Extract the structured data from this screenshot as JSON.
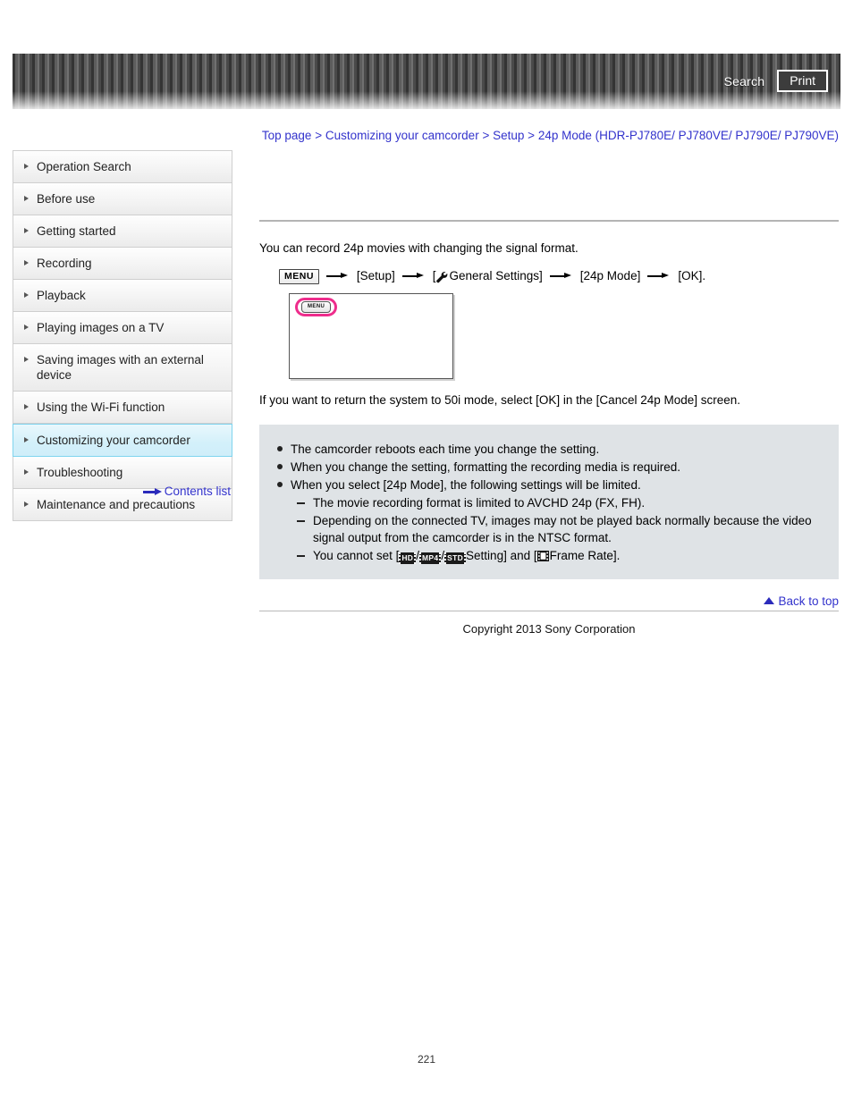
{
  "header": {
    "search_label": "Search",
    "print_label": "Print"
  },
  "breadcrumb": {
    "items": [
      {
        "label": "Top page"
      },
      {
        "label": "Customizing your camcorder"
      },
      {
        "label": "Setup"
      },
      {
        "label": "24p Mode (HDR-PJ780E/ PJ780VE/ PJ790E/ PJ790VE)"
      }
    ],
    "separator": ">"
  },
  "sidebar": {
    "items": [
      {
        "label": "Operation Search",
        "selected": false
      },
      {
        "label": "Before use",
        "selected": false
      },
      {
        "label": "Getting started",
        "selected": false
      },
      {
        "label": "Recording",
        "selected": false
      },
      {
        "label": "Playback",
        "selected": false
      },
      {
        "label": "Playing images on a TV",
        "selected": false
      },
      {
        "label": "Saving images with an external device",
        "selected": false
      },
      {
        "label": "Using the Wi-Fi function",
        "selected": false
      },
      {
        "label": "Customizing your camcorder",
        "selected": true
      },
      {
        "label": "Troubleshooting",
        "selected": false
      },
      {
        "label": "Maintenance and precautions",
        "selected": false
      }
    ],
    "contents_list_label": "Contents list",
    "contents_list_icon": "arrow-right-icon",
    "selected_bg_color": "#d3f0fa",
    "selected_border_color": "#7fd4ee"
  },
  "main": {
    "intro": "You can record 24p movies with changing the signal format.",
    "menu_path": {
      "menu_chip": "MENU",
      "step_setup": "[Setup]",
      "step_general_open": "[",
      "step_general": "General Settings]",
      "general_icon": "wrench-icon",
      "step_mode": "[24p Mode]",
      "step_ok": "[OK]."
    },
    "figure": {
      "menu_chip": "MENU",
      "highlight_color": "#ee2d8c"
    },
    "after_figure": "If you want to return the system to 50i mode, select [OK] in the [Cancel 24p Mode] screen.",
    "notes": [
      {
        "type": "bullet",
        "text": "The camcorder reboots each time you change the setting."
      },
      {
        "type": "bullet",
        "text": "When you change the setting, formatting the recording media is required."
      },
      {
        "type": "bullet",
        "text": "When you select [24p Mode], the following settings will be limited."
      },
      {
        "type": "dash",
        "text": "The movie recording format is limited to AVCHD 24p (FX, FH)."
      },
      {
        "type": "dash",
        "text": "Depending on the connected TV, images may not be played back normally because the video signal output from the camcorder is in the NTSC format."
      },
      {
        "type": "dash-icons",
        "prefix": "You cannot set [",
        "badge_hd": "HD",
        "sep1": "/",
        "badge_mp4": "MP4",
        "sep2": "/",
        "badge_std": "STD",
        "middle": "Setting] and [",
        "frame_icon": "film-frame-icon",
        "suffix": "Frame Rate]."
      }
    ],
    "back_to_top": "Back to top",
    "copyright": "Copyright 2013 Sony Corporation"
  },
  "footer": {
    "page_number": "221"
  }
}
